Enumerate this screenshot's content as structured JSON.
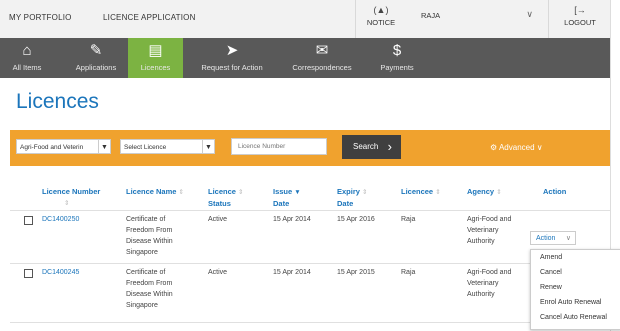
{
  "topbar": {
    "portfolio": "MY PORTFOLIO",
    "licence_application": "LICENCE APPLICATION",
    "notice": "NOTICE",
    "user": "RAJA",
    "logout": "LOGOUT"
  },
  "nav": [
    {
      "label": "All Items",
      "icon": "home-icon"
    },
    {
      "label": "Applications",
      "icon": "pencil-icon"
    },
    {
      "label": "Licences",
      "icon": "licence-icon"
    },
    {
      "label": "Request for Action",
      "icon": "request-icon"
    },
    {
      "label": "Correspondences",
      "icon": "envelope-icon"
    },
    {
      "label": "Payments",
      "icon": "payment-icon"
    }
  ],
  "active_nav": "Licences",
  "page_title": "Licences",
  "filter": {
    "agency_value": "Agri-Food and Veterin",
    "licence_select": "Select Licence",
    "licence_number_placeholder": "Licence Number",
    "search_label": "Search",
    "advanced_label": "Advanced"
  },
  "table": {
    "headers": {
      "licence_number": [
        "Licence Number"
      ],
      "licence_name": [
        "Licence Name"
      ],
      "licence_status": [
        "Licence",
        "Status"
      ],
      "issue_date": [
        "Issue",
        "Date"
      ],
      "expiry_date": [
        "Expiry",
        "Date"
      ],
      "licencee": [
        "Licencee"
      ],
      "agency": [
        "Agency"
      ],
      "action": [
        "Action"
      ]
    },
    "rows": [
      {
        "licence_number": "DC1400250",
        "licence_name": [
          "Certificate of",
          "Freedom From",
          "Disease Within",
          "Singapore"
        ],
        "status": "Active",
        "issue_date": "15 Apr 2014",
        "expiry_date": "15 Apr 2016",
        "licencee": "Raja",
        "agency": [
          "Agri-Food and",
          "Veterinary",
          "Authority"
        ]
      },
      {
        "licence_number": "DC1400245",
        "licence_name": [
          "Certificate of",
          "Freedom From",
          "Disease Within",
          "Singapore"
        ],
        "status": "Active",
        "issue_date": "15 Apr 2014",
        "expiry_date": "15 Apr 2015",
        "licencee": "Raja",
        "agency": [
          "Agri-Food and",
          "Veterinary",
          "Authority"
        ]
      }
    ]
  },
  "action_button": "Action",
  "action_menu": [
    "Amend",
    "Cancel",
    "Renew",
    "Enrol Auto Renewal",
    "Cancel Auto Renewal"
  ],
  "colors": {
    "nav_bg": "#595959",
    "nav_active": "#7cb342",
    "filter_bar": "#f0a22e",
    "accent_blue": "#1b75bb"
  }
}
